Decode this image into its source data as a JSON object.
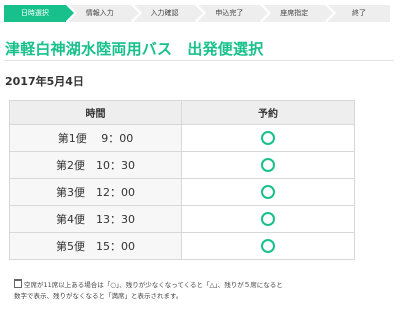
{
  "steps": [
    {
      "label": "日時選択",
      "active": true
    },
    {
      "label": "情報入力",
      "active": false
    },
    {
      "label": "入力確認",
      "active": false
    },
    {
      "label": "申込完了",
      "active": false
    },
    {
      "label": "座席指定",
      "active": false
    },
    {
      "label": "終了",
      "active": false
    }
  ],
  "page_title": "津軽白神湖水陸両用バス　出発便選択",
  "date": "2017年5月4日",
  "table": {
    "headers": {
      "time": "時間",
      "availability": "予約"
    },
    "rows": [
      {
        "time": "第1便　 9：00",
        "status": "○"
      },
      {
        "time": "第2便　10：30",
        "status": "○"
      },
      {
        "time": "第3便　12：00",
        "status": "○"
      },
      {
        "time": "第4便　13：30",
        "status": "○"
      },
      {
        "time": "第5便　15：00",
        "status": "○"
      }
    ]
  },
  "note_line1": "空席が11席以上ある場合は「○」、残りが少なくなってくると「△」、残りが５席になると",
  "note_line2": "数字で表示、残りがなくなると「満席」と表示されます。",
  "colors": {
    "accent": "#18c18b"
  }
}
